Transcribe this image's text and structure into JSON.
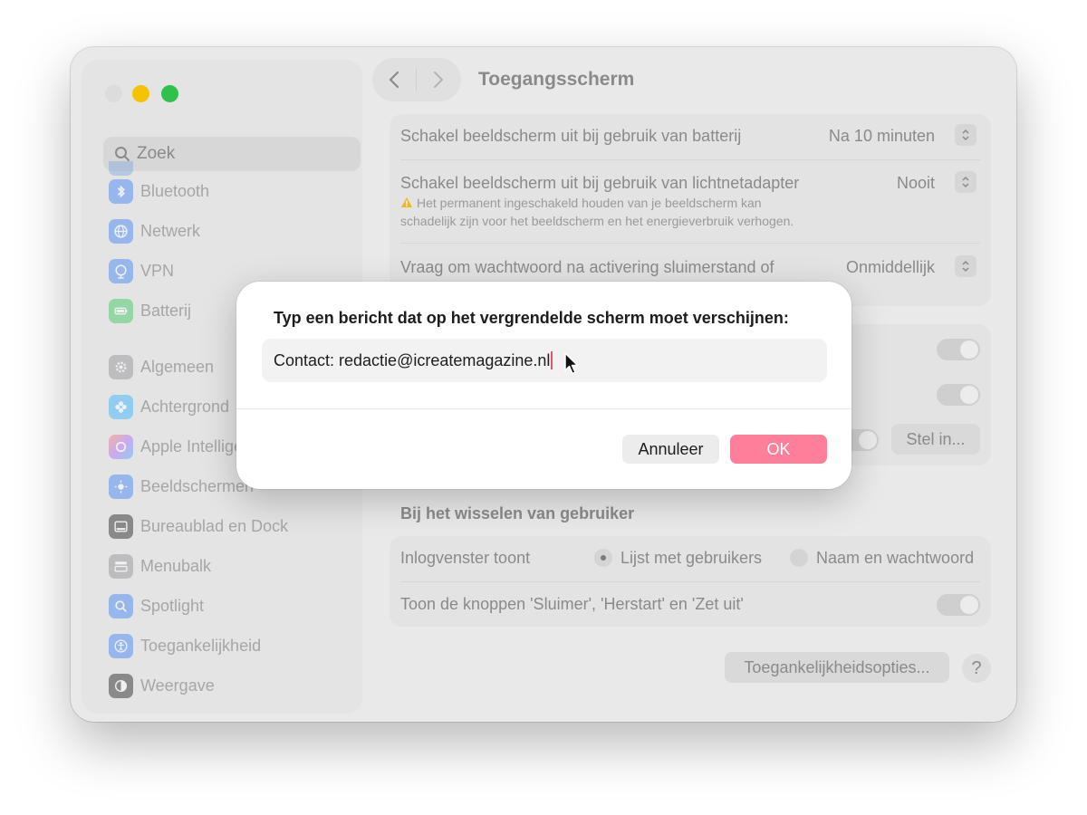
{
  "window": {
    "title": "Toegangsscherm"
  },
  "sidebar": {
    "search_placeholder": "Zoek",
    "items": [
      {
        "label": "Bluetooth",
        "icon": "bluetooth-icon",
        "color": "#3b82f6"
      },
      {
        "label": "Netwerk",
        "icon": "globe-icon",
        "color": "#3b82f6"
      },
      {
        "label": "VPN",
        "icon": "vpn-globe-icon",
        "color": "#3b82f6"
      },
      {
        "label": "Batterij",
        "icon": "battery-icon",
        "color": "#34c759"
      },
      {
        "label": "Algemeen",
        "icon": "gear-icon",
        "color": "#8e8e93"
      },
      {
        "label": "Achtergrond",
        "icon": "flower-icon",
        "color": "#30b0ff"
      },
      {
        "label": "Apple Intellige",
        "icon": "apple-intelligence-icon",
        "color": "#ff7b54"
      },
      {
        "label": "Beeldschermen",
        "icon": "sun-icon",
        "color": "#3b82f6"
      },
      {
        "label": "Bureaublad en Dock",
        "icon": "dock-icon",
        "color": "#1d1d1f"
      },
      {
        "label": "Menubalk",
        "icon": "menubar-icon",
        "color": "#8e8e93"
      },
      {
        "label": "Spotlight",
        "icon": "magnifier-icon",
        "color": "#3b82f6"
      },
      {
        "label": "Toegankelijkheid",
        "icon": "accessibility-icon",
        "color": "#3b82f6"
      },
      {
        "label": "Weergave",
        "icon": "appearance-icon",
        "color": "#1d1d1f"
      }
    ]
  },
  "main": {
    "display_off_battery": {
      "label": "Schakel beeldscherm uit bij gebruik van batterij",
      "value": "Na 10 minuten"
    },
    "display_off_adapter": {
      "label": "Schakel beeldscherm uit bij gebruik van lichtnetadapter",
      "value": "Nooit",
      "warning_line1": "Het permanent ingeschakeld houden van je beeldscherm kan",
      "warning_line2": "schadelijk zijn voor het beeldscherm en het energieverbruik verhogen."
    },
    "require_password": {
      "label": "Vraag om wachtwoord na activering sluimerstand of",
      "value": "Onmiddellijk"
    },
    "set_button": "Stel in...",
    "switch_section_title": "Bij het wisselen van gebruiker",
    "login_window": {
      "label": "Inlogvenster toont",
      "option_list": "Lijst met gebruikers",
      "option_name": "Naam en wachtwoord"
    },
    "show_buttons_label": "Toon de knoppen 'Sluimer', 'Herstart' en 'Zet uit'",
    "accessibility_button": "Toegankelijkheidsopties...",
    "help": "?"
  },
  "dialog": {
    "title": "Typ een bericht dat op het vergrendelde scherm moet verschijnen:",
    "input_value": "Contact: redactie@icreatemagazine.nl",
    "cancel_label": "Annuleer",
    "ok_label": "OK",
    "accent_color": "#ff7f9a"
  }
}
